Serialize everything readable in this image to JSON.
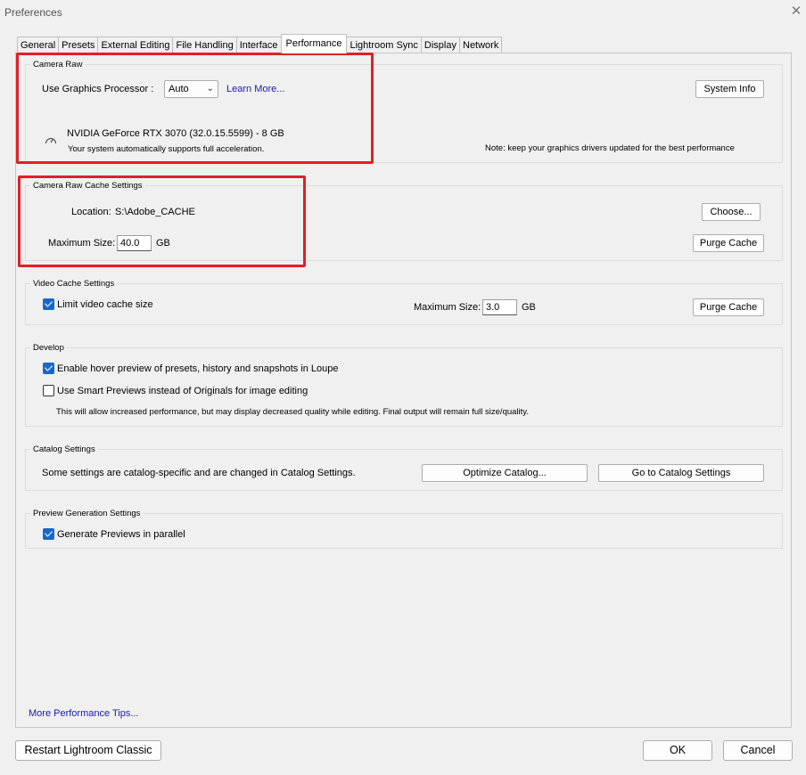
{
  "window": {
    "title": "Preferences"
  },
  "tabs": [
    {
      "label": "General",
      "active": false
    },
    {
      "label": "Presets",
      "active": false
    },
    {
      "label": "External Editing",
      "active": false
    },
    {
      "label": "File Handling",
      "active": false
    },
    {
      "label": "Interface",
      "active": false
    },
    {
      "label": "Performance",
      "active": true
    },
    {
      "label": "Lightroom Sync",
      "active": false
    },
    {
      "label": "Display",
      "active": false
    },
    {
      "label": "Network",
      "active": false
    }
  ],
  "camera_raw": {
    "legend": "Camera Raw",
    "gpu_label": "Use Graphics Processor :",
    "gpu_value": "Auto",
    "learn_more": "Learn More...",
    "system_info": "System Info",
    "gpu_name": "NVIDIA GeForce RTX 3070 (32.0.15.5599) - 8 GB",
    "gpu_status": "Your system automatically supports full acceleration.",
    "note": "Note: keep your graphics drivers updated for the best performance"
  },
  "cache": {
    "legend": "Camera Raw Cache Settings",
    "location_label": "Location:",
    "location_value": "S:\\Adobe_CACHE",
    "choose": "Choose...",
    "max_label": "Maximum Size:",
    "max_value": "40.0",
    "unit": "GB",
    "purge": "Purge Cache"
  },
  "video_cache": {
    "legend": "Video Cache Settings",
    "limit_label": "Limit video cache size",
    "limit_checked": true,
    "max_label": "Maximum Size:",
    "max_value": "3.0",
    "unit": "GB",
    "purge": "Purge Cache"
  },
  "develop": {
    "legend": "Develop",
    "hover_label": "Enable hover preview of presets, history and snapshots in Loupe",
    "hover_checked": true,
    "smart_label": "Use Smart Previews instead of Originals for image editing",
    "smart_checked": false,
    "smart_note": "This will allow increased performance, but may display decreased quality while editing. Final output will remain full size/quality."
  },
  "catalog": {
    "legend": "Catalog Settings",
    "text": "Some settings are catalog-specific and are changed in Catalog Settings.",
    "optimize": "Optimize Catalog...",
    "goto": "Go to Catalog Settings"
  },
  "preview": {
    "legend": "Preview Generation Settings",
    "parallel_label": "Generate Previews in parallel",
    "parallel_checked": true
  },
  "more_tips": "More Performance Tips...",
  "footer": {
    "restart": "Restart Lightroom Classic",
    "ok": "OK",
    "cancel": "Cancel"
  },
  "colors": {
    "highlight": "#e02025",
    "checkbox": "#1769c7",
    "link": "#1a1ab4"
  }
}
